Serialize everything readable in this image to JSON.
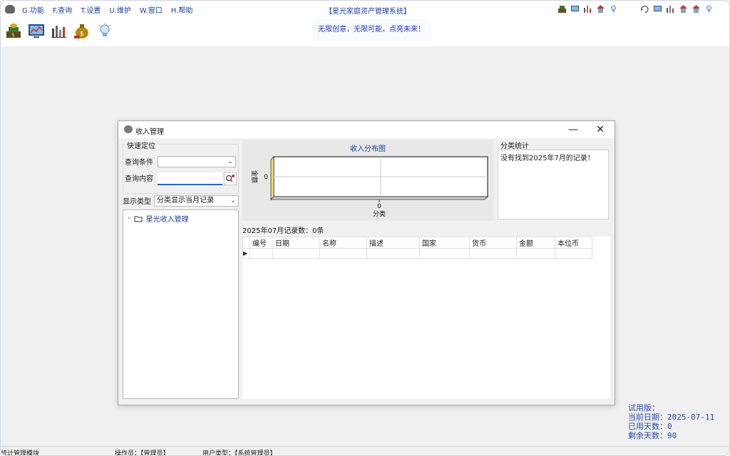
{
  "menu": {
    "items": [
      "G.功能",
      "F.查询",
      "T.设置",
      "U.维护",
      "W.窗口",
      "H.帮助"
    ]
  },
  "app_title": "【星光家庭资产管理系统】",
  "slogan": "无限创意，无限可能，点亮未来！",
  "toolbar": {
    "icons": [
      "money-bag-icon",
      "monitor-chart-icon",
      "bar-chart-icon",
      "dollar-bag-icon",
      "lightbulb-icon"
    ]
  },
  "dialog": {
    "title": "收入管理",
    "quick_locate": {
      "group_title": "快速定位",
      "query_condition_label": "查询条件",
      "query_condition_value": "",
      "query_content_label": "查询内容",
      "query_content_value": ""
    },
    "display_type": {
      "label": "显示类型",
      "value": "分类显示当月记录"
    },
    "tree": {
      "root_label": "星光收入管理"
    },
    "chart_data": {
      "type": "bar",
      "title": "收入分布图",
      "xlabel": "分类",
      "ylabel": "金额",
      "categories": [
        "0"
      ],
      "values": [],
      "y_ticks": [
        "0"
      ],
      "grid": true
    },
    "stats": {
      "group_title": "分类统计",
      "message": "没有找到2025年7月的记录！"
    },
    "record_count": "2025年07月记录数：0条",
    "grid": {
      "columns": [
        "编号",
        "日期",
        "名称",
        "描述",
        "国家",
        "货币",
        "金额",
        "本位币"
      ],
      "rows": []
    }
  },
  "trial": {
    "line1": "试用版：",
    "line2": "当前日期：2025-07-11",
    "line3": "已用天数：0",
    "line4": "剩余天数：90"
  },
  "statusbar": {
    "module": "统计管理模块",
    "operator": "操作员：【管理员】",
    "user_type": "用户类型：【系统管理员】"
  }
}
